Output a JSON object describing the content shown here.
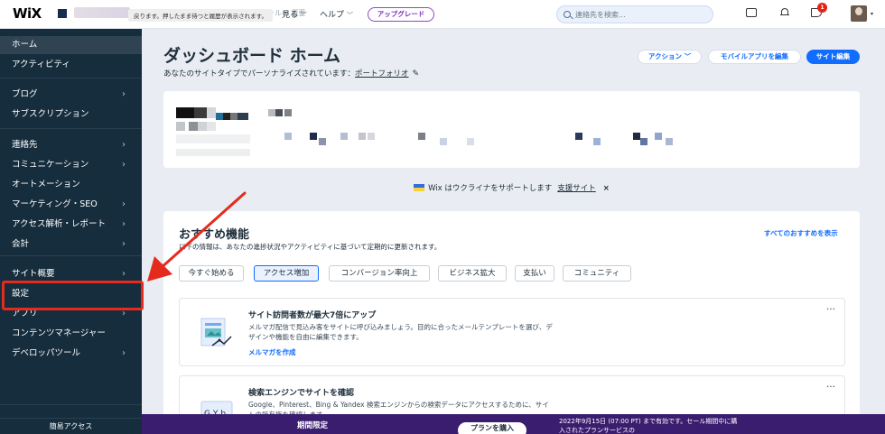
{
  "topbar": {
    "logo": "WiX",
    "tooltip": "戻ります。押したまま待つと履歴が表示されます。",
    "faded_nav": "ブ・ビジネス・ツール・ 概要",
    "view_label": "見る",
    "help_label": "ヘルプ",
    "upgrade_label": "アップグレード",
    "search_placeholder": "連絡先を検索...",
    "notification_count": "1"
  },
  "sidebar": {
    "items": [
      {
        "label": "ホーム",
        "chevron": false,
        "active": true
      },
      {
        "label": "アクティビティ",
        "chevron": false
      },
      {
        "label": "ブログ",
        "chevron": true
      },
      {
        "label": "サブスクリプション",
        "chevron": false
      },
      {
        "label": "連絡先",
        "chevron": true
      },
      {
        "label": "コミュニケーション",
        "chevron": true
      },
      {
        "label": "オートメーション",
        "chevron": false
      },
      {
        "label": "マーケティング・SEO",
        "chevron": true
      },
      {
        "label": "アクセス解析・レポート",
        "chevron": true
      },
      {
        "label": "会計",
        "chevron": true
      },
      {
        "label": "サイト概要",
        "chevron": true
      },
      {
        "label": "設定",
        "chevron": false
      },
      {
        "label": "アプリ",
        "chevron": true
      },
      {
        "label": "コンテンツマネージャー",
        "chevron": false
      },
      {
        "label": "デベロッパツール",
        "chevron": true
      }
    ],
    "bottom_label": "簡易アクセス"
  },
  "main": {
    "title": "ダッシュボード ホーム",
    "subtitle": "あなたのサイトタイプでパーソナライズされています：",
    "subtitle_link": "ポートフォリオ",
    "action_button": "アクション",
    "mobile_button": "モバイルアプリを編集",
    "edit_button": "サイト編集"
  },
  "ukraine": {
    "text": "Wix はウクライナをサポートします",
    "link": "支援サイト",
    "close": "×"
  },
  "recommendations": {
    "title": "おすすめ機能",
    "description": "以下の情報は、あなたの進捗状況やアクティビティに基づいて定期的に更新されます。",
    "view_all": "すべてのおすすめを表示",
    "chips": [
      "今すぐ始める",
      "アクセス増加",
      "コンバージョン率向上",
      "ビジネス拡大",
      "支払い",
      "コミュニティ"
    ],
    "active_chip_index": 1,
    "features": [
      {
        "title": "サイト訪問者数が最大7倍にアップ",
        "description": "メルマガ配信で見込み客をサイトに呼び込みましょう。目的に合ったメールテンプレートを選び、デザインや機能を自由に編集できます。",
        "link": "メルマガを作成",
        "more": "…"
      },
      {
        "title": "検索エンジンでサイトを確認",
        "description": "Google、Pinterest、Bing & Yandex 検索エンジンからの検索データにアクセスするために、サイトの所有権を確認します。",
        "link": "",
        "more": "…"
      }
    ]
  },
  "promo": {
    "label": "期間限定",
    "button": "プランを購入",
    "text": "2022年9月15日 (07:00 PT) まで有効です。セール期間中に購入されたプランサービスの"
  },
  "colors": {
    "sidebar_bg": "#162d3d",
    "accent_blue": "#116dff",
    "upgrade_purple": "#7a2fb8",
    "promo_bg": "#3b1d6f",
    "highlight_red": "#e42b1e"
  }
}
